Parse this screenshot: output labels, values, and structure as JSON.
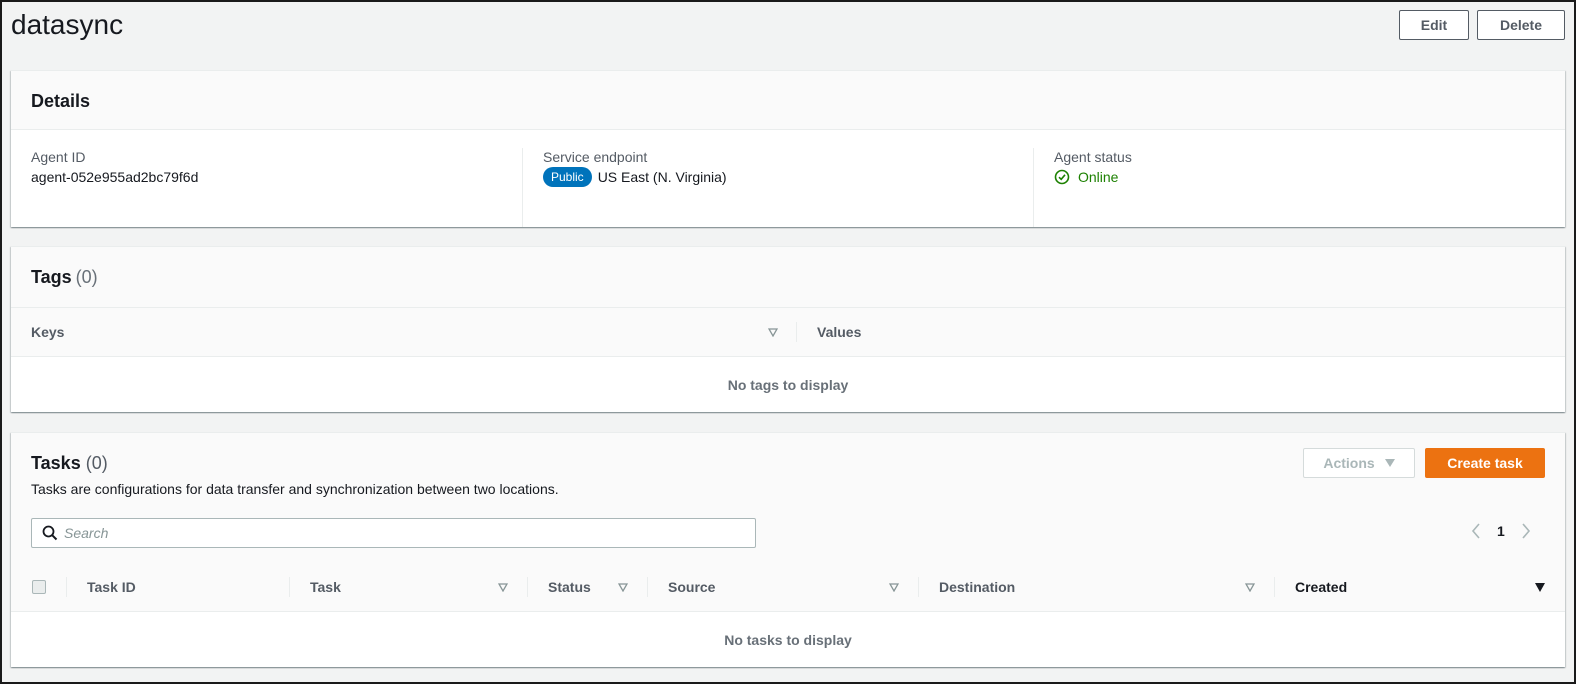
{
  "header": {
    "title": "datasync",
    "edit_label": "Edit",
    "delete_label": "Delete"
  },
  "details": {
    "title": "Details",
    "agent_id_label": "Agent ID",
    "agent_id": "agent-052e955ad2bc79f6d",
    "endpoint_label": "Service endpoint",
    "endpoint_badge": "Public",
    "endpoint_value": "US East (N. Virginia)",
    "status_label": "Agent status",
    "status_value": "Online",
    "status_color": "#1d8102"
  },
  "tags": {
    "title": "Tags",
    "count": "(0)",
    "columns": [
      "Keys",
      "Values"
    ],
    "empty_text": "No tags to display"
  },
  "tasks": {
    "title": "Tasks",
    "count": "(0)",
    "description": "Tasks are configurations for data transfer and synchronization between two locations.",
    "actions_label": "Actions",
    "create_label": "Create task",
    "search_placeholder": "Search",
    "page_number": "1",
    "columns": [
      "Task ID",
      "Task",
      "Status",
      "Source",
      "Destination",
      "Created"
    ],
    "empty_text": "No tasks to display"
  },
  "colors": {
    "accent_orange": "#ec7211",
    "badge_blue": "#0073bb"
  }
}
